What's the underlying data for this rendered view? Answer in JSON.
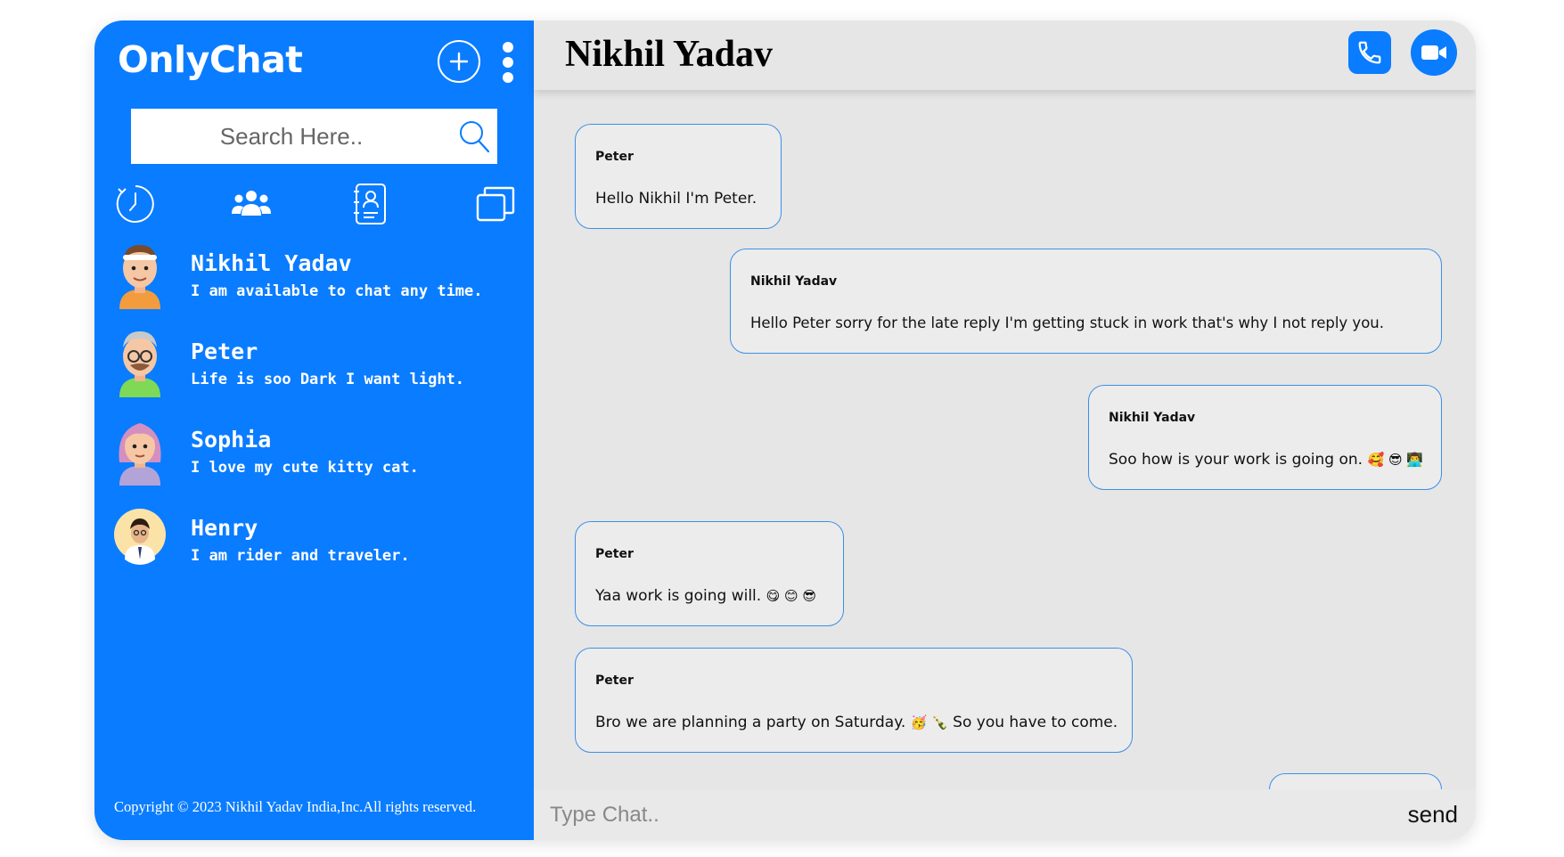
{
  "sidebar": {
    "brand": "OnlyChat",
    "search_placeholder": "Search Here..",
    "contacts": [
      {
        "name": "Nikhil Yadav",
        "status": "I am available to chat any time."
      },
      {
        "name": "Peter",
        "status": "Life is soo Dark I want light."
      },
      {
        "name": "Sophia",
        "status": "I love my cute kitty cat."
      },
      {
        "name": "Henry",
        "status": "I am rider and traveler."
      }
    ],
    "copyright": "Copyright © 2023 Nikhil Yadav India,Inc.All rights reserved."
  },
  "chat": {
    "title": "Nikhil Yadav",
    "messages": [
      {
        "sender": "Peter",
        "text": "Hello Nikhil I'm Peter.",
        "emoji": ""
      },
      {
        "sender": "Nikhil Yadav",
        "text": "Hello Peter sorry for the late reply I'm getting stuck in work that's why I not reply you.",
        "emoji": ""
      },
      {
        "sender": "Nikhil Yadav",
        "text": "Soo how is your work is going on.",
        "emoji": "🥰 😎 👨‍💻"
      },
      {
        "sender": "Peter",
        "text": "Yaa work is going will.",
        "emoji": "😋 😊 😎"
      },
      {
        "sender": "Peter",
        "text": "Bro we are planning a party on Saturday.",
        "emoji": "🥳 🍾",
        "text_after": "So you have to come."
      }
    ],
    "composer_placeholder": "Type Chat..",
    "send_label": "send"
  },
  "colors": {
    "accent": "#0a7cff",
    "chat_bg": "#e6e6e6",
    "bubble_border": "#3d8fe8"
  }
}
